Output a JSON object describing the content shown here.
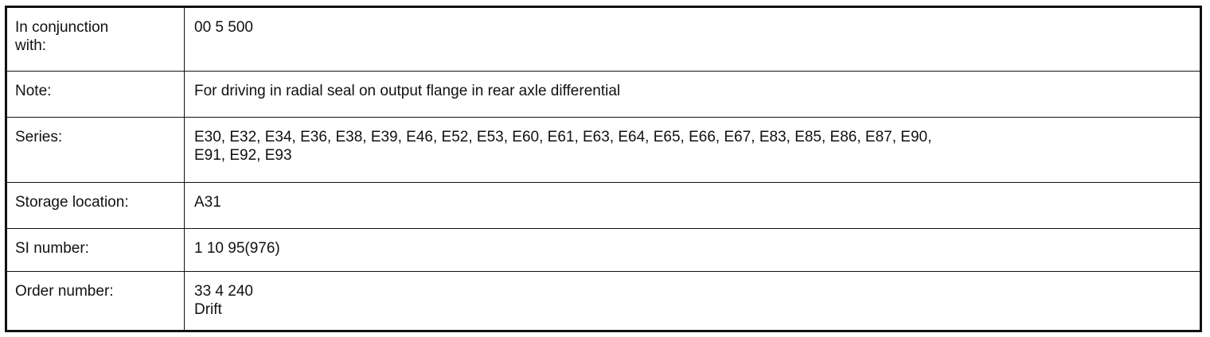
{
  "rows": [
    {
      "label": "In conjunction\nwith:",
      "values": [
        "00 5 500"
      ]
    },
    {
      "label": "Note:",
      "values": [
        "For driving in radial seal on output flange in rear axle differential"
      ]
    },
    {
      "label": "Series:",
      "values": [
        "E30, E32, E34, E36, E38, E39, E46, E52, E53, E60, E61, E63, E64, E65, E66, E67, E83, E85, E86, E87, E90,",
        "E91, E92, E93"
      ]
    },
    {
      "label": "Storage location:",
      "values": [
        "A31"
      ]
    },
    {
      "label": "SI number:",
      "values": [
        "1 10 95(976)"
      ]
    },
    {
      "label": "Order number:",
      "values": [
        "33 4 240",
        "Drift"
      ]
    }
  ]
}
